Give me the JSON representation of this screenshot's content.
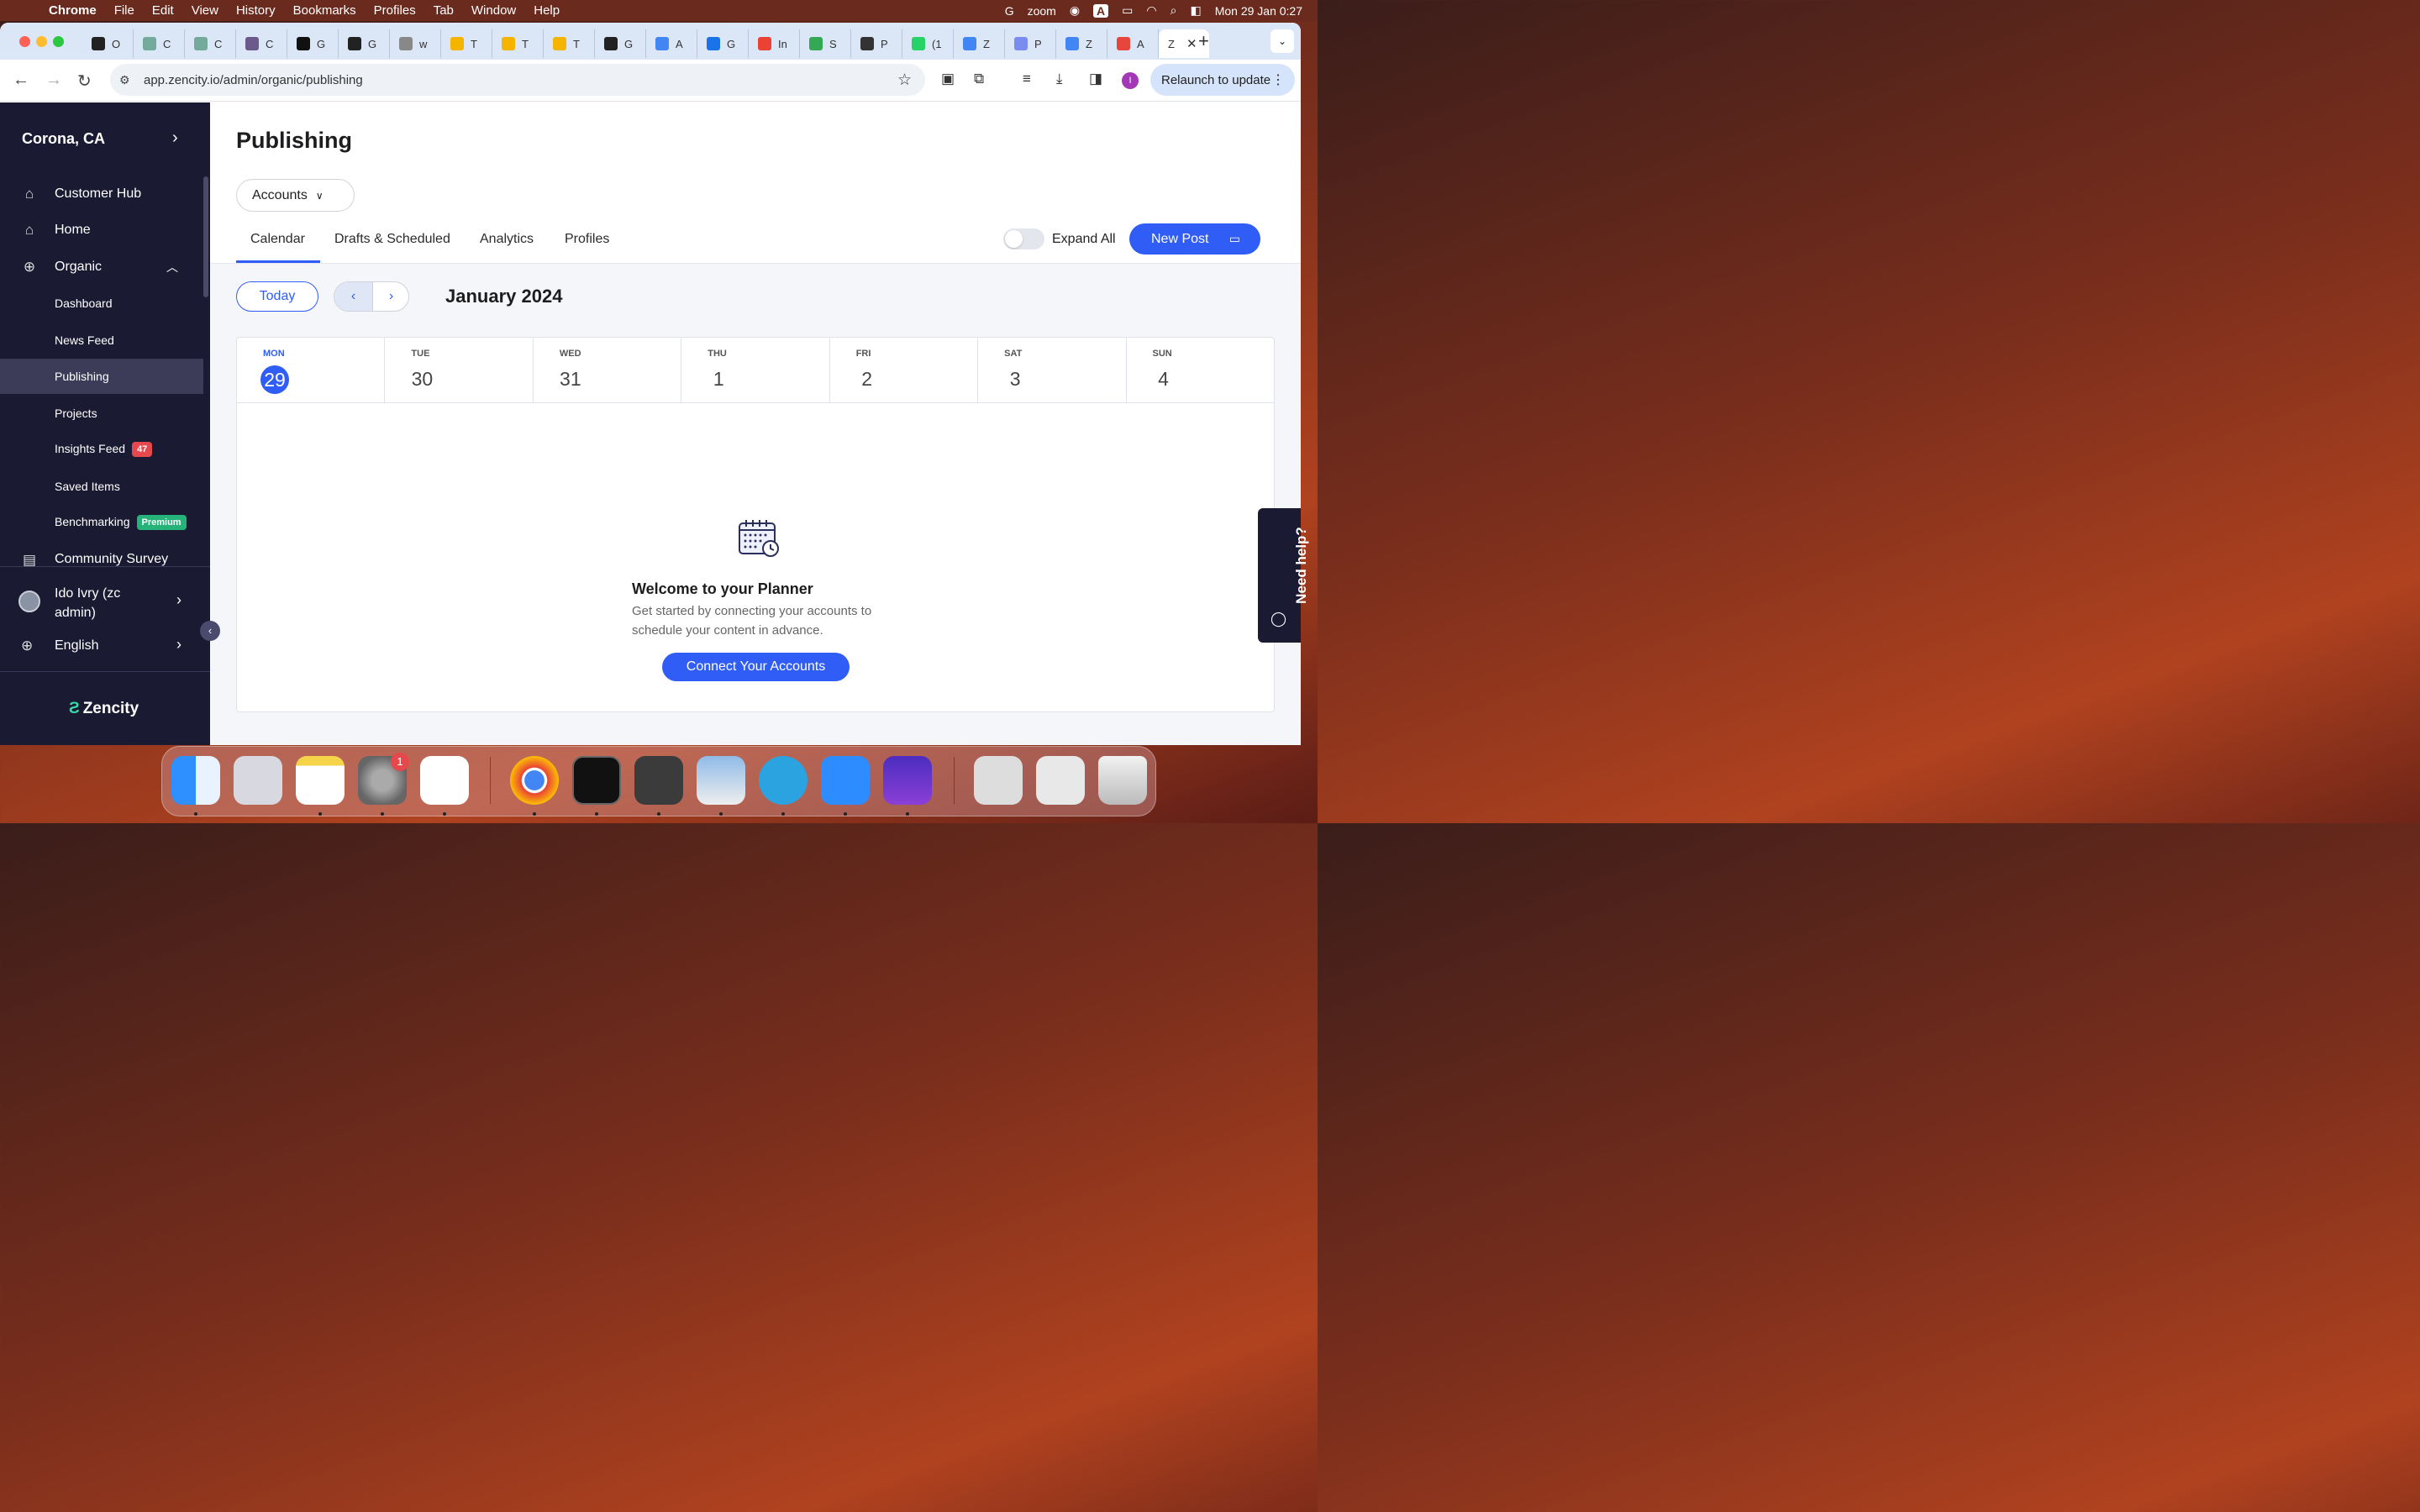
{
  "menubar": {
    "app": "Chrome",
    "items": [
      "File",
      "Edit",
      "View",
      "History",
      "Bookmarks",
      "Profiles",
      "Tab",
      "Window",
      "Help"
    ],
    "status": {
      "zoom": "zoom",
      "datetime": "Mon 29 Jan  0:27"
    }
  },
  "browser": {
    "tabs": [
      {
        "letter": "O",
        "color": "#222"
      },
      {
        "letter": "C",
        "color": "#74aa9c"
      },
      {
        "letter": "C",
        "color": "#74aa9c"
      },
      {
        "letter": "C",
        "color": "#6b5a8a"
      },
      {
        "letter": "G",
        "color": "#111"
      },
      {
        "letter": "G",
        "color": "#222"
      },
      {
        "letter": "w",
        "color": "#888"
      },
      {
        "letter": "T",
        "color": "#f4b400"
      },
      {
        "letter": "T",
        "color": "#f4b400"
      },
      {
        "letter": "T",
        "color": "#f4b400"
      },
      {
        "letter": "G",
        "color": "#222"
      },
      {
        "letter": "A",
        "color": "#4285f4"
      },
      {
        "letter": "G",
        "color": "#1a73e8"
      },
      {
        "letter": "In",
        "color": "#ea4335"
      },
      {
        "letter": "S",
        "color": "#34a853"
      },
      {
        "letter": "P",
        "color": "#333"
      },
      {
        "letter": "(1",
        "color": "#25d366"
      },
      {
        "letter": "Z",
        "color": "#4285f4"
      },
      {
        "letter": "P",
        "color": "#7b8cf0"
      },
      {
        "letter": "Z",
        "color": "#4285f4"
      },
      {
        "letter": "A",
        "color": "#e8453c"
      }
    ],
    "active_tab": {
      "letter": "Z"
    },
    "url": "app.zencity.io/admin/organic/publishing",
    "relaunch": "Relaunch to update",
    "profile_initial": "I"
  },
  "sidebar": {
    "city": "Corona, CA",
    "items": [
      {
        "label": "Customer Hub",
        "icon": "home-icon"
      },
      {
        "label": "Home",
        "icon": "home-icon"
      },
      {
        "label": "Organic",
        "icon": "globe-icon"
      }
    ],
    "subitems": [
      {
        "label": "Dashboard"
      },
      {
        "label": "News Feed"
      },
      {
        "label": "Publishing"
      },
      {
        "label": "Projects"
      },
      {
        "label": "Insights Feed",
        "badge": "47"
      },
      {
        "label": "Saved Items"
      },
      {
        "label": "Benchmarking",
        "badge": "Premium"
      }
    ],
    "community": "Community Survey",
    "user": "Ido Ivry (zc admin)",
    "language": "English",
    "brand": "Zencity"
  },
  "main": {
    "title": "Publishing",
    "accounts": "Accounts",
    "tabs": [
      "Calendar",
      "Drafts & Scheduled",
      "Analytics",
      "Profiles"
    ],
    "expand_all": "Expand All",
    "new_post": "New Post",
    "today": "Today",
    "month": "January 2024",
    "days": [
      {
        "name": "MON",
        "date": "29"
      },
      {
        "name": "TUE",
        "date": "30"
      },
      {
        "name": "WED",
        "date": "31"
      },
      {
        "name": "THU",
        "date": "1"
      },
      {
        "name": "FRI",
        "date": "2"
      },
      {
        "name": "SAT",
        "date": "3"
      },
      {
        "name": "SUN",
        "date": "4"
      }
    ],
    "welcome_title": "Welcome to your Planner",
    "welcome_sub": "Get started by connecting your accounts to schedule your content in advance.",
    "connect": "Connect Your Accounts",
    "need_help": "Need help?"
  },
  "dock": {
    "badge": "1"
  },
  "colors": {
    "accent": "#2f5df5",
    "sidebar": "#1b1a33",
    "premium": "#26b37a",
    "alert": "#e5484d"
  }
}
